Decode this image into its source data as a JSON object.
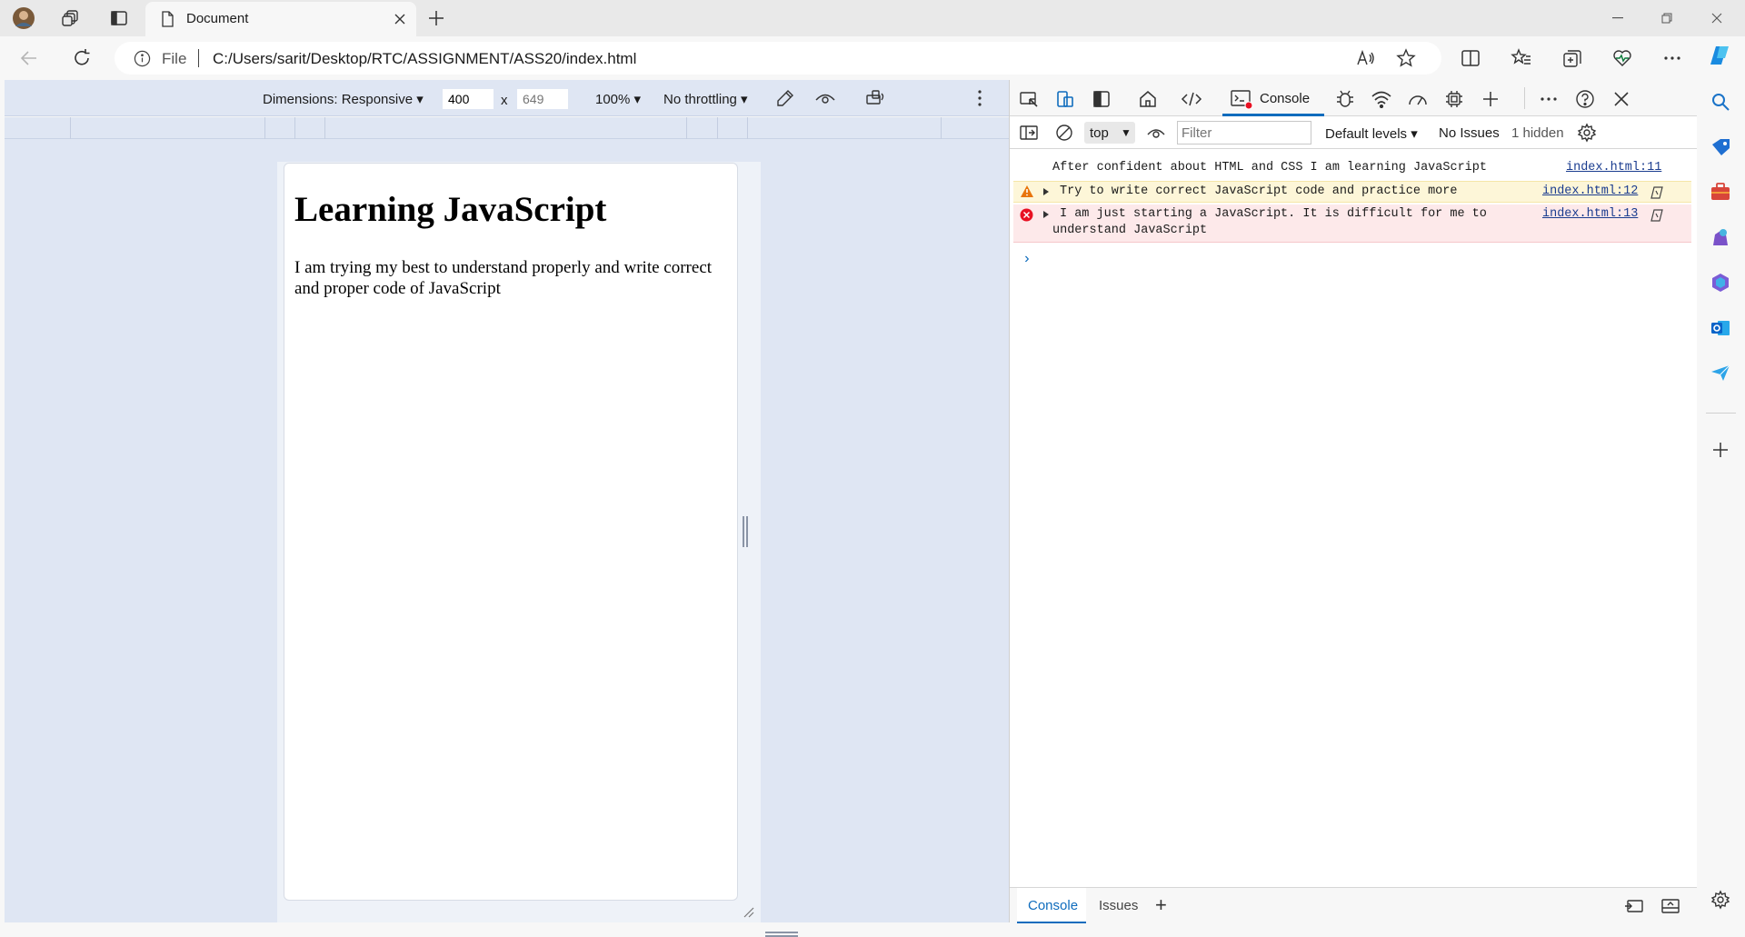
{
  "browser": {
    "tab_title": "Document",
    "address_scheme_label": "File",
    "address_url": "C:/Users/sarit/Desktop/RTC/ASSIGNMENT/ASS20/index.html"
  },
  "device_toolbar": {
    "dimensions_label": "Dimensions: Responsive",
    "width_value": "400",
    "times_symbol": "x",
    "height_placeholder": "649",
    "zoom_label": "100%",
    "throttling_label": "No throttling"
  },
  "page": {
    "heading": "Learning JavaScript",
    "paragraph": "I am trying my best to understand properly and write correct and proper code of JavaScript"
  },
  "devtools": {
    "console_tab_label": "Console",
    "context_label": "top",
    "filter_placeholder": "Filter",
    "levels_label": "Default levels",
    "issues_label": "No Issues",
    "hidden_label": "1 hidden",
    "messages": [
      {
        "level": "log",
        "text": "After confident about HTML and CSS I am learning JavaScript",
        "source": "index.html:11"
      },
      {
        "level": "warning",
        "text": "Try to write correct JavaScript code and practice more",
        "source": "index.html:12"
      },
      {
        "level": "error",
        "text": "I am just starting a JavaScript. It is difficult for me to\nunderstand JavaScript",
        "source": "index.html:13"
      }
    ],
    "prompt_symbol": "›",
    "drawer_tabs": [
      "Console",
      "Issues"
    ],
    "drawer_add": "+"
  },
  "colors": {
    "accent": "#0f6cbd",
    "warning_bg": "#fdf6d8",
    "error_bg": "#fde9ea",
    "device_toolbar_bg": "#dfe6f3"
  }
}
